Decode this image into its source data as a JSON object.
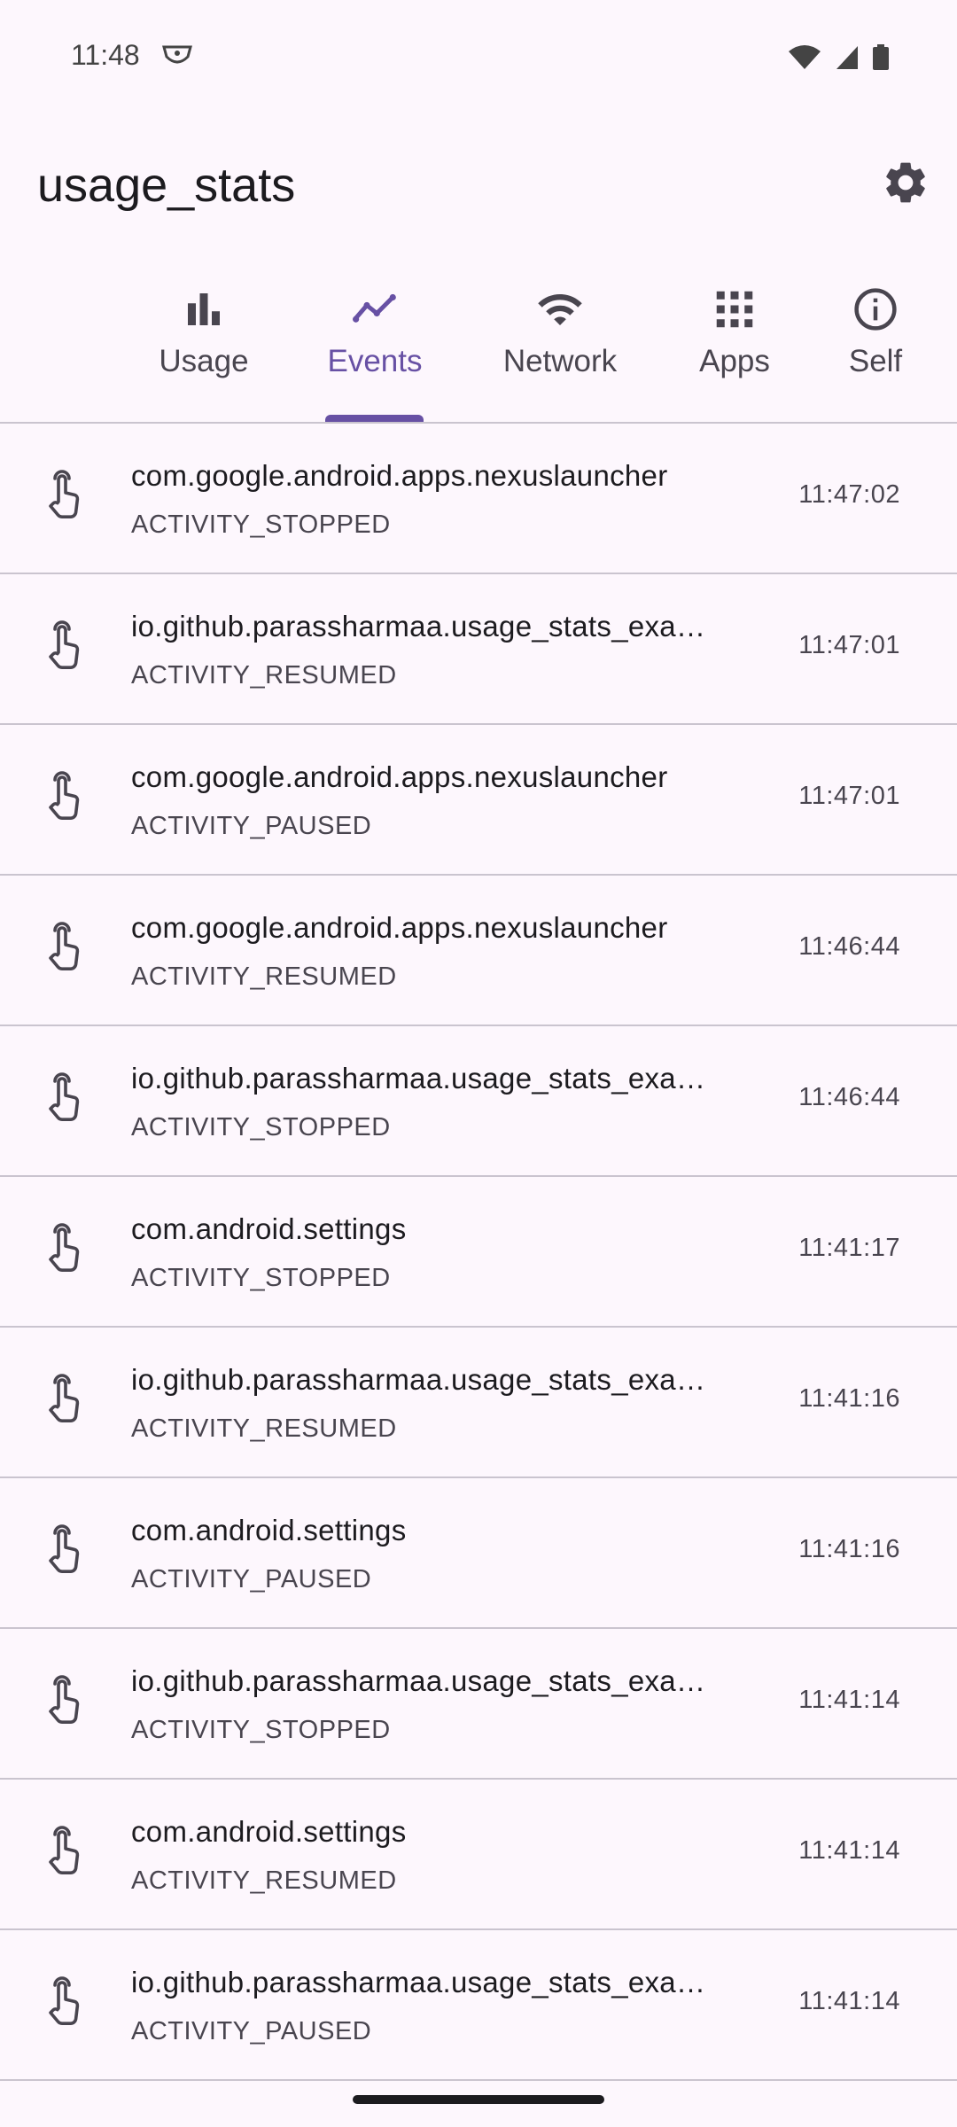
{
  "status_bar": {
    "time": "11:48",
    "icons": [
      "shield-icon",
      "wifi-icon",
      "signal-icon",
      "battery-icon"
    ]
  },
  "app_bar": {
    "title": "usage_stats",
    "action_icon": "gear-icon"
  },
  "tabs": [
    {
      "label": "Usage",
      "icon": "bar-chart-icon",
      "active": false
    },
    {
      "label": "Events",
      "icon": "trend-line-icon",
      "active": true
    },
    {
      "label": "Network",
      "icon": "wifi-icon",
      "active": false
    },
    {
      "label": "Apps",
      "icon": "grid-icon",
      "active": false
    },
    {
      "label": "Self",
      "icon": "info-icon",
      "active": false
    }
  ],
  "colors": {
    "accent": "#6750a4",
    "background": "#fdf7fd",
    "divider": "#cac4cf"
  },
  "events": [
    {
      "package": "com.google.android.apps.nexuslauncher",
      "type": "ACTIVITY_STOPPED",
      "time": "11:47:02"
    },
    {
      "package": "io.github.parassharmaa.usage_stats_exa…",
      "type": "ACTIVITY_RESUMED",
      "time": "11:47:01"
    },
    {
      "package": "com.google.android.apps.nexuslauncher",
      "type": "ACTIVITY_PAUSED",
      "time": "11:47:01"
    },
    {
      "package": "com.google.android.apps.nexuslauncher",
      "type": "ACTIVITY_RESUMED",
      "time": "11:46:44"
    },
    {
      "package": "io.github.parassharmaa.usage_stats_exa…",
      "type": "ACTIVITY_STOPPED",
      "time": "11:46:44"
    },
    {
      "package": "com.android.settings",
      "type": "ACTIVITY_STOPPED",
      "time": "11:41:17"
    },
    {
      "package": "io.github.parassharmaa.usage_stats_exa…",
      "type": "ACTIVITY_RESUMED",
      "time": "11:41:16"
    },
    {
      "package": "com.android.settings",
      "type": "ACTIVITY_PAUSED",
      "time": "11:41:16"
    },
    {
      "package": "io.github.parassharmaa.usage_stats_exa…",
      "type": "ACTIVITY_STOPPED",
      "time": "11:41:14"
    },
    {
      "package": "com.android.settings",
      "type": "ACTIVITY_RESUMED",
      "time": "11:41:14"
    },
    {
      "package": "io.github.parassharmaa.usage_stats_exa…",
      "type": "ACTIVITY_PAUSED",
      "time": "11:41:14"
    }
  ]
}
